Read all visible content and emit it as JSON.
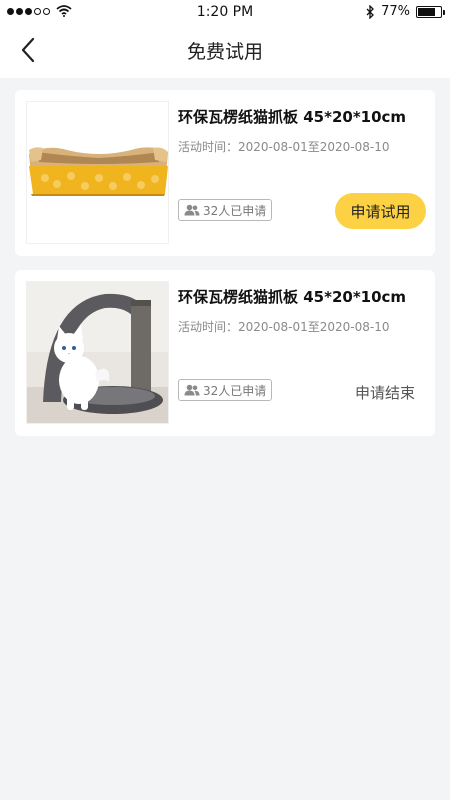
{
  "status_bar": {
    "time": "1:20 PM",
    "battery": "77%",
    "battery_level": 0.77
  },
  "header": {
    "title": "免费试用",
    "back_icon": "chevron-left-icon"
  },
  "items": [
    {
      "title": "环保瓦楞纸猫抓板 45*20*10cm",
      "date": "活动时间：2020-08-01至2020-08-10",
      "applicants": "32人已申请",
      "action": "申请试用",
      "status": "active"
    },
    {
      "title": "环保瓦楞纸猫抓板 45*20*10cm",
      "date": "活动时间：2020-08-01至2020-08-10",
      "applicants": "32人已申请",
      "action": "申请结束",
      "status": "ended"
    }
  ],
  "colors": {
    "accent": "#fcd143",
    "background": "#f3f4f6"
  }
}
